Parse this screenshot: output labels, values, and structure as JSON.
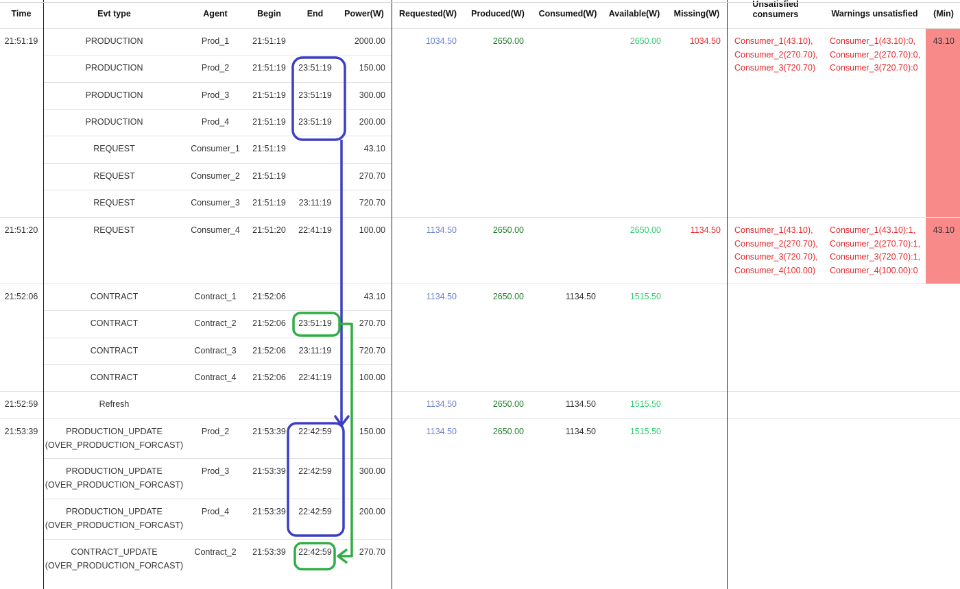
{
  "header": {
    "time": "Time",
    "evt_type": "Evt type",
    "agent": "Agent",
    "begin": "Begin",
    "end": "End",
    "power": "Power(W)",
    "requested": "Requested(W)",
    "produced": "Produced(W)",
    "consumed": "Consumed(W)",
    "available": "Available(W)",
    "missing": "Missing(W)",
    "unsatisfied_top": "Unsatisfied",
    "unsatisfied_bottom": "consumers",
    "warnings": "Warnings unsatisfied",
    "min": "(Min)"
  },
  "groups": [
    {
      "time": "21:51:19",
      "events": [
        {
          "evt": "PRODUCTION",
          "agent": "Prod_1",
          "begin": "21:51:19",
          "end": "",
          "power": "2000.00"
        },
        {
          "evt": "PRODUCTION",
          "agent": "Prod_2",
          "begin": "21:51:19",
          "end": "23:51:19",
          "power": "150.00"
        },
        {
          "evt": "PRODUCTION",
          "agent": "Prod_3",
          "begin": "21:51:19",
          "end": "23:51:19",
          "power": "300.00"
        },
        {
          "evt": "PRODUCTION",
          "agent": "Prod_4",
          "begin": "21:51:19",
          "end": "23:51:19",
          "power": "200.00"
        },
        {
          "evt": "REQUEST",
          "agent": "Consumer_1",
          "begin": "21:51:19",
          "end": "",
          "power": "43.10"
        },
        {
          "evt": "REQUEST",
          "agent": "Consumer_2",
          "begin": "21:51:19",
          "end": "",
          "power": "270.70"
        },
        {
          "evt": "REQUEST",
          "agent": "Consumer_3",
          "begin": "21:51:19",
          "end": "23:11:19",
          "power": "720.70"
        }
      ],
      "requested": "1034.50",
      "produced": "2650.00",
      "consumed": "",
      "available": "2650.00",
      "missing": "1034.50",
      "unsatisfied": [
        "Consumer_1(43.10),",
        "Consumer_2(270.70),",
        "Consumer_3(720.70)"
      ],
      "warnings": [
        "Consumer_1(43.10):0,",
        "Consumer_2(270.70):0,",
        "Consumer_3(720.70):0"
      ],
      "min": "43.10"
    },
    {
      "time": "21:51:20",
      "events": [
        {
          "evt": "REQUEST",
          "agent": "Consumer_4",
          "begin": "21:51:20",
          "end": "22:41:19",
          "power": "100.00"
        }
      ],
      "requested": "1134.50",
      "produced": "2650.00",
      "consumed": "",
      "available": "2650.00",
      "missing": "1134.50",
      "unsatisfied": [
        "Consumer_1(43.10),",
        "Consumer_2(270.70),",
        "Consumer_3(720.70),",
        "Consumer_4(100.00)"
      ],
      "warnings": [
        "Consumer_1(43.10):1,",
        "Consumer_2(270.70):1,",
        "Consumer_3(720.70):1,",
        "Consumer_4(100.00):0"
      ],
      "min": "43.10"
    },
    {
      "time": "21:52:06",
      "events": [
        {
          "evt": "CONTRACT",
          "agent": "Contract_1",
          "begin": "21:52:06",
          "end": "",
          "power": "43.10"
        },
        {
          "evt": "CONTRACT",
          "agent": "Contract_2",
          "begin": "21:52:06",
          "end": "23:51:19",
          "power": "270.70"
        },
        {
          "evt": "CONTRACT",
          "agent": "Contract_3",
          "begin": "21:52:06",
          "end": "23:11:19",
          "power": "720.70"
        },
        {
          "evt": "CONTRACT",
          "agent": "Contract_4",
          "begin": "21:52:06",
          "end": "22:41:19",
          "power": "100.00"
        }
      ],
      "requested": "1134.50",
      "produced": "2650.00",
      "consumed": "1134.50",
      "available": "1515.50",
      "missing": "",
      "unsatisfied": [],
      "warnings": [],
      "min": ""
    },
    {
      "time": "21:52:59",
      "events": [
        {
          "evt": "Refresh",
          "agent": "",
          "begin": "",
          "end": "",
          "power": ""
        }
      ],
      "requested": "1134.50",
      "produced": "2650.00",
      "consumed": "1134.50",
      "available": "1515.50",
      "missing": "",
      "unsatisfied": [],
      "warnings": [],
      "min": ""
    },
    {
      "time": "21:53:39",
      "events": [
        {
          "evt": "PRODUCTION_UPDATE\n(OVER_PRODUCTION_FORCAST)",
          "agent": "Prod_2",
          "begin": "21:53:39",
          "end": "22:42:59",
          "power": "150.00"
        },
        {
          "evt": "PRODUCTION_UPDATE\n(OVER_PRODUCTION_FORCAST)",
          "agent": "Prod_3",
          "begin": "21:53:39",
          "end": "22:42:59",
          "power": "300.00"
        },
        {
          "evt": "PRODUCTION_UPDATE\n(OVER_PRODUCTION_FORCAST)",
          "agent": "Prod_4",
          "begin": "21:53:39",
          "end": "22:42:59",
          "power": "200.00"
        },
        {
          "evt": "CONTRACT_UPDATE\n(OVER_PRODUCTION_FORCAST)",
          "agent": "Contract_2",
          "begin": "21:53:39",
          "end": "22:42:59",
          "power": "270.70"
        }
      ],
      "requested": "1134.50",
      "produced": "2650.00",
      "consumed": "1134.50",
      "available": "1515.50",
      "missing": "",
      "unsatisfied": [],
      "warnings": [],
      "min": ""
    }
  ],
  "colors": {
    "requested": "#6a7fd2",
    "produced": "#1f7a2a",
    "available": "#2ecc71",
    "missing": "#e8282b",
    "min_bg": "#f98a8a",
    "annot_blue": "#3b3fc4",
    "annot_green": "#2fae44"
  }
}
